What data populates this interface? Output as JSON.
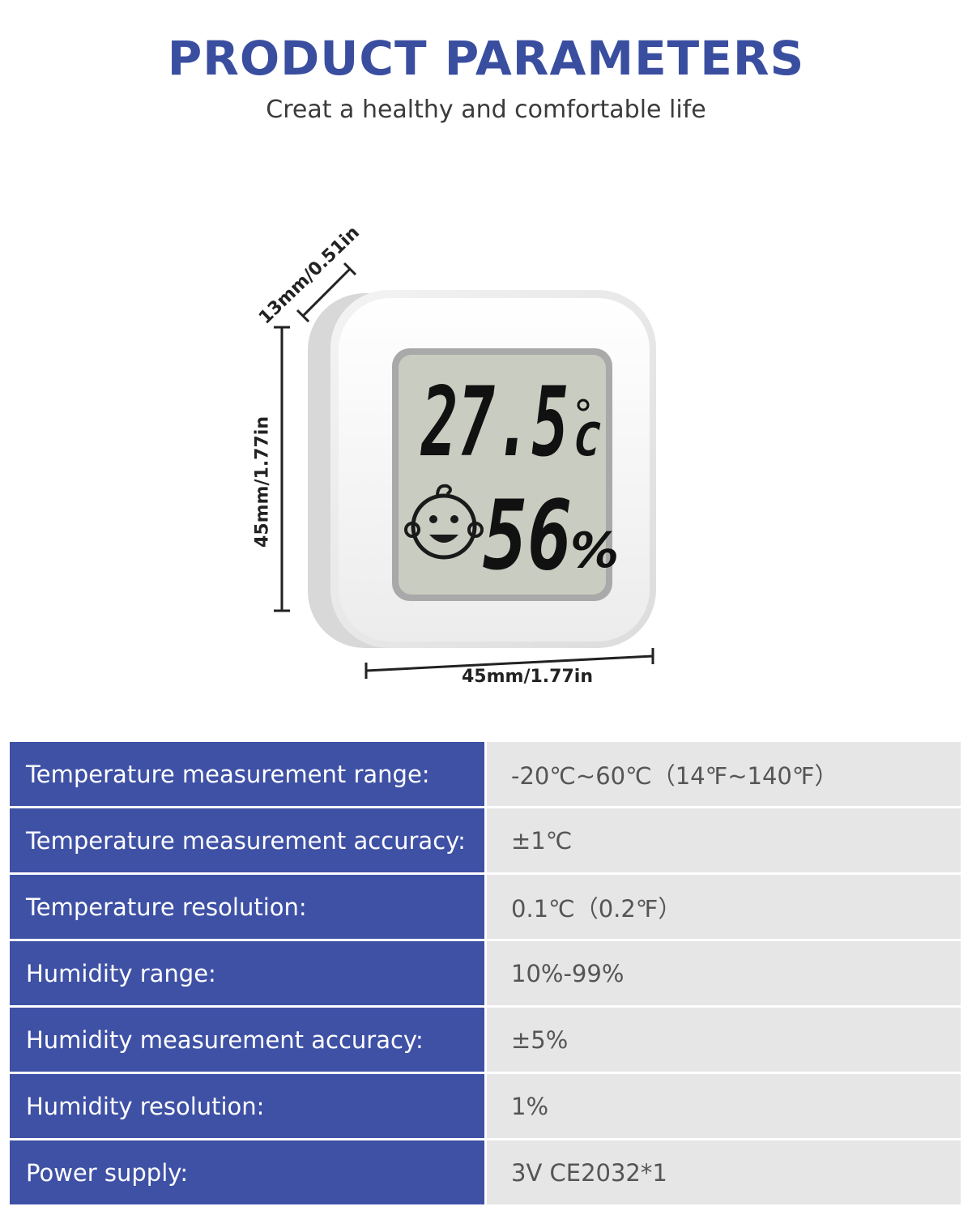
{
  "header": {
    "title": "PRODUCT PARAMETERS",
    "subtitle": "Creat a healthy and comfortable life"
  },
  "product": {
    "display": {
      "temperature": "27.5",
      "temp_unit": "C",
      "humidity": "56",
      "humidity_unit": "%"
    },
    "dimensions": {
      "depth": "13mm/0.51in",
      "height": "45mm/1.77in",
      "width": "45mm/1.77in"
    }
  },
  "specs": [
    {
      "label": "Temperature measurement range:",
      "value": "-20℃~60℃（14℉~140℉）"
    },
    {
      "label": "Temperature measurement accuracy:",
      "value": "±1℃"
    },
    {
      "label": "Temperature resolution:",
      "value": "0.1℃（0.2℉）"
    },
    {
      "label": "Humidity range:",
      "value": "10%-99%"
    },
    {
      "label": "Humidity measurement accuracy:",
      "value": "±5%"
    },
    {
      "label": "Humidity resolution:",
      "value": "1%"
    },
    {
      "label": "Power supply:",
      "value": "3V CE2032*1"
    }
  ],
  "colors": {
    "title": "#3a4ea0",
    "label_bg": "#3f51a5",
    "value_bg": "#e6e6e6",
    "lcd": "#c9ccc0"
  }
}
